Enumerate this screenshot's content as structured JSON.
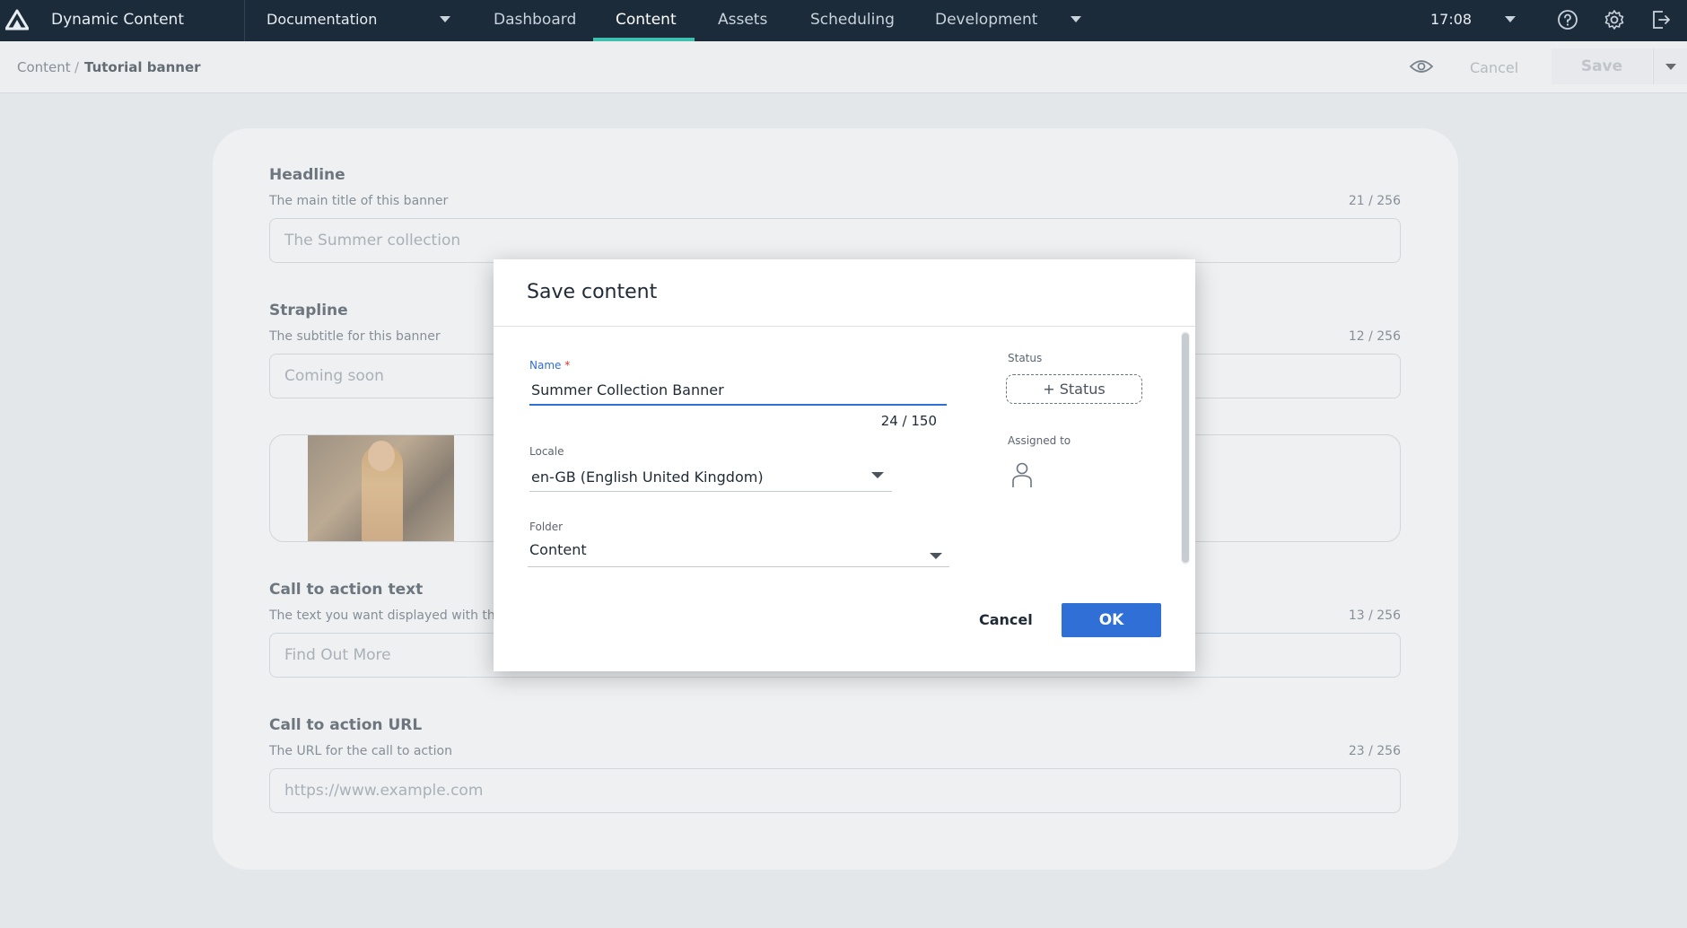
{
  "topbar": {
    "app_title": "Dynamic Content",
    "hub": "Documentation",
    "nav": [
      "Dashboard",
      "Content",
      "Assets",
      "Scheduling",
      "Development"
    ],
    "active_nav": "Content",
    "clock": "17:08"
  },
  "subbar": {
    "crumb_root": "Content",
    "crumb_sep": "/",
    "crumb_current": "Tutorial banner",
    "cancel_label": "Cancel",
    "save_label": "Save"
  },
  "form": {
    "headline": {
      "label": "Headline",
      "desc": "The main title of this banner",
      "count": "21 / 256",
      "value": "The Summer collection"
    },
    "strapline": {
      "label": "Strapline",
      "desc": "The subtitle for this banner",
      "count": "12 / 256",
      "value": "Coming soon"
    },
    "cta_text": {
      "label": "Call to action text",
      "desc": "The text you want displayed with the",
      "count": "13 / 256",
      "value": "Find Out More"
    },
    "cta_url": {
      "label": "Call to action URL",
      "desc": "The URL for the call to action",
      "count": "23 / 256",
      "value": "https://www.example.com"
    }
  },
  "modal": {
    "title": "Save content",
    "name_label": "Name",
    "name_required": "*",
    "name_value": "Summer Collection Banner",
    "name_count": "24 / 150",
    "locale_label": "Locale",
    "locale_value": "en-GB (English United Kingdom)",
    "folder_label": "Folder",
    "folder_value": "Content",
    "status_label": "Status",
    "status_button": "+ Status",
    "assigned_label": "Assigned to",
    "cancel_label": "Cancel",
    "ok_label": "OK"
  },
  "colors": {
    "nav_bg": "#1b2b3a",
    "accent": "#3fbfae",
    "primary": "#2f6fd6",
    "required": "#d0342c"
  }
}
